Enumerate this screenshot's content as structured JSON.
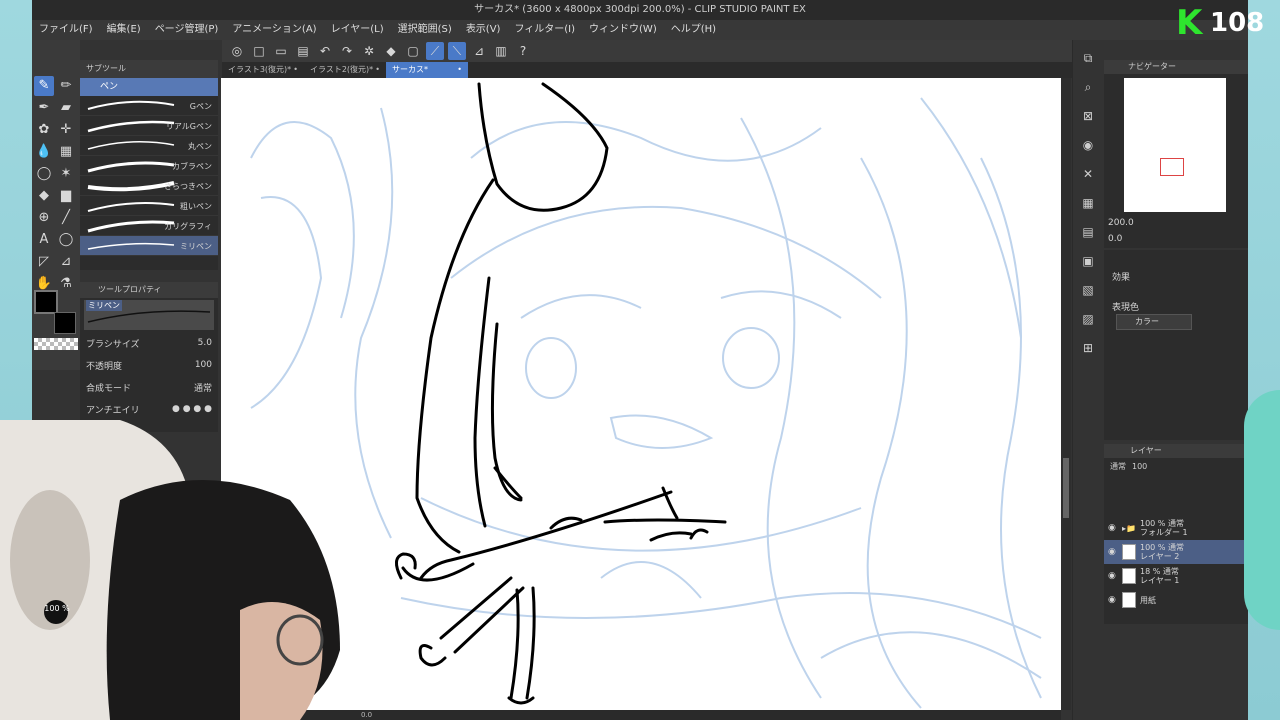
{
  "window": {
    "title": "サーカス* (3600 x 4800px 300dpi 200.0%) - CLIP STUDIO PAINT EX"
  },
  "menu": [
    "ファイル(F)",
    "編集(E)",
    "ページ管理(P)",
    "アニメーション(A)",
    "レイヤー(L)",
    "選択範囲(S)",
    "表示(V)",
    "フィルター(I)",
    "ウィンドウ(W)",
    "ヘルプ(H)"
  ],
  "tabs": [
    {
      "label": "イラスト3(復元)*"
    },
    {
      "label": "イラスト2(復元)*"
    },
    {
      "label": "サーカス*"
    }
  ],
  "subtool": {
    "header": "サブツール",
    "active_tab": "ペン",
    "brushes": [
      "Gペン",
      "リアルGペン",
      "丸ペン",
      "カブラペン",
      "さらつきペン",
      "粗いペン",
      "カリグラフィ",
      "ミリペン"
    ]
  },
  "toolprop": {
    "header": "ツールプロパティ",
    "preview_label": "ミリペン",
    "brush_size_label": "ブラシサイズ",
    "brush_size_value": "5.0",
    "opacity_label": "不透明度",
    "opacity_value": "100",
    "blend_label": "合成モード",
    "blend_value": "通常",
    "antialias_label": "アンチエイリ"
  },
  "navigator": {
    "header": "ナビゲーター",
    "zoom": "200.0",
    "rotate": "0.0"
  },
  "effect": {
    "label": "効果",
    "expression_label": "表現色",
    "expression_value": "カラー"
  },
  "layers": {
    "header": "レイヤー",
    "blend": "通常",
    "opacity": "100",
    "rows": [
      {
        "line1": "100 % 通常",
        "line2": "フォルダー 1"
      },
      {
        "line1": "100 % 通常",
        "line2": "レイヤー 2"
      },
      {
        "line1": "18 % 通常",
        "line2": "レイヤー 1"
      },
      {
        "line1": "",
        "line2": "用紙"
      }
    ]
  },
  "overlay": {
    "logo_k": "K",
    "logo_num": "108",
    "webcam_badge": "100 %"
  },
  "status": {
    "zoom_readout": "0.0"
  },
  "colors": {
    "accent": "#4a7ac8",
    "canvas": "#ffffff",
    "sketch": "#b7cfea",
    "ink": "#000000"
  }
}
